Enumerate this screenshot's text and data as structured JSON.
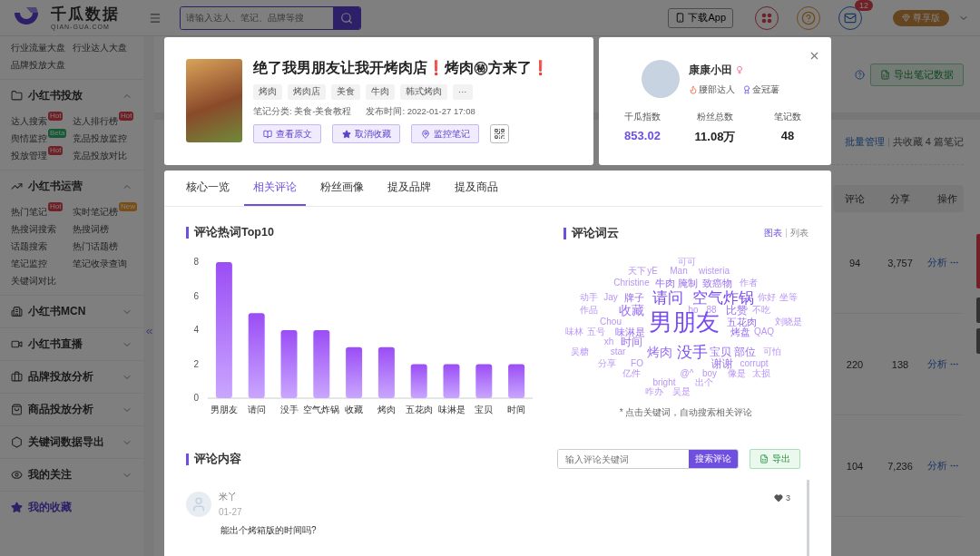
{
  "header": {
    "logo": {
      "name": "千瓜数据",
      "domain": "QIAN-GUA.COM"
    },
    "search": {
      "placeholder": "请输入达人、笔记、品牌等搜"
    },
    "download_button": "下载App",
    "mail_badge": "12",
    "plan_button": "尊享版"
  },
  "sidebar": {
    "top_links": [
      "行业流量大盘",
      "行业达人大盘",
      "品牌投放大盘"
    ],
    "sections": [
      {
        "title": "小红书投放",
        "expanded": true,
        "items": [
          {
            "label": "达人搜索",
            "badge": {
              "text": "Hot",
              "color": "#702127"
            }
          },
          {
            "label": "达人排行榜",
            "badge": {
              "text": "Hot",
              "color": "#702127"
            }
          },
          {
            "label": "舆情监控",
            "badge": {
              "text": "Beta",
              "color": "#155935"
            }
          },
          {
            "label": "竞品投放监控"
          },
          {
            "label": "投放管理",
            "badge": {
              "text": "Hot",
              "color": "#702127"
            }
          },
          {
            "label": "竞品投放对比"
          }
        ]
      },
      {
        "title": "小红书运营",
        "expanded": true,
        "items": [
          {
            "label": "热门笔记",
            "badge": {
              "text": "Hot",
              "color": "#702127"
            }
          },
          {
            "label": "实时笔记榜",
            "badge": {
              "text": "New",
              "color": "#785015"
            }
          },
          {
            "label": "热搜词搜索"
          },
          {
            "label": "热搜词榜"
          },
          {
            "label": "话题搜索"
          },
          {
            "label": "热门话题榜"
          },
          {
            "label": "笔记监控"
          },
          {
            "label": "笔记收录查询"
          },
          {
            "label": "关键词对比"
          }
        ]
      },
      {
        "title": "小红书MCN",
        "expanded": false
      },
      {
        "title": "小红书直播",
        "expanded": false
      },
      {
        "title": "品牌投放分析",
        "expanded": false
      },
      {
        "title": "商品投放分析",
        "expanded": false
      },
      {
        "title": "关键词数据导出",
        "expanded": false
      },
      {
        "title": "我的关注",
        "expanded": false
      }
    ],
    "favorites": {
      "label": "我的收藏",
      "selected": true
    }
  },
  "background": {
    "export_button": "导出笔记数据",
    "batch_link": "批量管理",
    "summary": "共收藏 4 篇笔记",
    "columns": [
      "评论",
      "分享",
      "操作"
    ],
    "rows": [
      {
        "comments": "94",
        "shares": "3,757",
        "action": "分析"
      },
      {
        "comments": "220",
        "shares": "138",
        "action": "分析"
      },
      {
        "comments": "104",
        "shares": "7,236",
        "action": "分析"
      }
    ]
  },
  "note": {
    "title": "绝了我男朋友让我开烤肉店❗烤肉㊙方来了❗",
    "tags": [
      "烤肉",
      "烤肉店",
      "美食",
      "牛肉",
      "韩式烤肉",
      "···"
    ],
    "category": "笔记分类: 美食-美食教程",
    "published": "发布时间: 2022-01-27 17:08",
    "buttons": [
      "查看原文",
      "取消收藏",
      "监控笔记"
    ]
  },
  "author": {
    "name": "康康小田",
    "level": "腰部达人",
    "award": "金冠薯",
    "stats": [
      {
        "label": "千瓜指数",
        "value": "853.02",
        "kind": "accent"
      },
      {
        "label": "粉丝总数",
        "value": "11.08万",
        "kind": "plain"
      },
      {
        "label": "笔记数",
        "value": "48",
        "kind": "plain"
      }
    ]
  },
  "tabs": [
    {
      "label": "核心一览",
      "selected": false
    },
    {
      "label": "相关评论",
      "selected": true
    },
    {
      "label": "粉丝画像",
      "selected": false
    },
    {
      "label": "提及品牌",
      "selected": false
    },
    {
      "label": "提及商品",
      "selected": false
    }
  ],
  "hot_words": {
    "title": "评论热词Top10",
    "chart_data": {
      "type": "bar",
      "categories": [
        "男朋友",
        "请问",
        "没手",
        "空气炸锅",
        "收藏",
        "烤肉",
        "五花肉",
        "味淋是",
        "宝贝",
        "时间"
      ],
      "values": [
        8,
        5,
        4,
        4,
        3,
        3,
        2,
        2,
        2,
        2
      ],
      "ylim": [
        0,
        8
      ],
      "yticks": [
        0,
        2,
        4,
        6,
        8
      ]
    }
  },
  "word_cloud": {
    "title": "评论词云",
    "views": [
      {
        "label": "图表",
        "selected": true
      },
      {
        "label": "列表",
        "selected": false
      }
    ],
    "words": [
      "可可",
      "天下",
      "yE",
      "Man",
      "wisteria",
      "Christine",
      "牛肉",
      "腌制",
      "致癌物",
      "作者",
      "动手",
      "Jay",
      "牌子",
      "请问",
      "空气炸锅",
      "你好",
      "坐等",
      "作品",
      "收藏",
      "ho",
      "88",
      "比赞",
      "不吃",
      "Chou",
      "男朋友",
      "五花肉",
      "刘晓是",
      "味林",
      "五号",
      "味淋是",
      "烤盘",
      "QAQ",
      "xh",
      "时间",
      "吴糖",
      "star",
      "烤肉",
      "没手",
      "宝贝",
      "部位",
      "可怕",
      "分享",
      "FO",
      "谢谢",
      "corrupt",
      "亿件",
      "@^",
      "boy",
      "像是",
      "太损",
      "bright",
      "出个",
      "咋办",
      "吴是"
    ],
    "hint": "* 点击关键词，自动搜索相关评论"
  },
  "comments": {
    "title": "评论内容",
    "search": {
      "placeholder": "输入评论关键词"
    },
    "search_button": "搜索评论",
    "export_button": "导出",
    "items": [
      {
        "user": "米丫",
        "date": "01-27",
        "likes": "3",
        "text": "能出个烤箱版的时间吗?"
      }
    ]
  }
}
